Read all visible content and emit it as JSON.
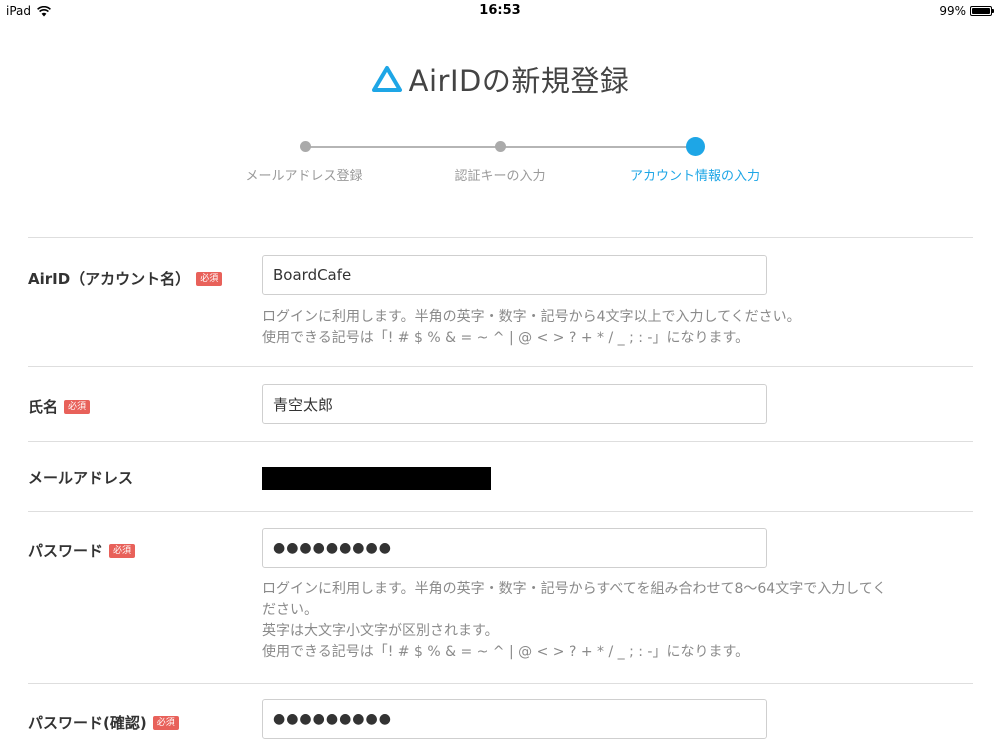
{
  "status_bar": {
    "device": "iPad",
    "time": "16:53",
    "battery": "99%",
    "battery_level": 0.99
  },
  "title": {
    "text": "AirIDの新規登録",
    "logo_icon": "triangle-logo-icon",
    "logo_color": "#1ea6e6"
  },
  "stepper": {
    "active_color": "#1ea6e6",
    "steps": [
      {
        "label": "メールアドレス登録",
        "state": "done"
      },
      {
        "label": "認証キーの入力",
        "state": "done"
      },
      {
        "label": "アカウント情報の入力",
        "state": "active"
      }
    ]
  },
  "form": {
    "airid": {
      "label": "AirID（アカウント名）",
      "required": "必須",
      "value": "BoardCafe",
      "hint_1": "ログインに利用します。半角の英字・数字・記号から4文字以上で入力してください。",
      "hint_2": "使用できる記号は「! # $ % & = ~ ^ | @ < > ? + * / _ ; : -」になります。"
    },
    "name": {
      "label": "氏名",
      "required": "必須",
      "value": "青空太郎"
    },
    "email": {
      "label": "メールアドレス"
    },
    "password": {
      "label": "パスワード",
      "required": "必須",
      "value": "●●●●●●●●●",
      "hint_1": "ログインに利用します。半角の英字・数字・記号からすべてを組み合わせて8〜64文字で入力してく",
      "hint_2": "ださい。",
      "hint_3": "英字は大文字小文字が区別されます。",
      "hint_4": "使用できる記号は「! # $ % & = ~ ^ | @ < > ? + * / _ ; : -」になります。"
    },
    "password_confirm": {
      "label": "パスワード(確認)",
      "required": "必須",
      "value": "●●●●●●●●●"
    }
  }
}
